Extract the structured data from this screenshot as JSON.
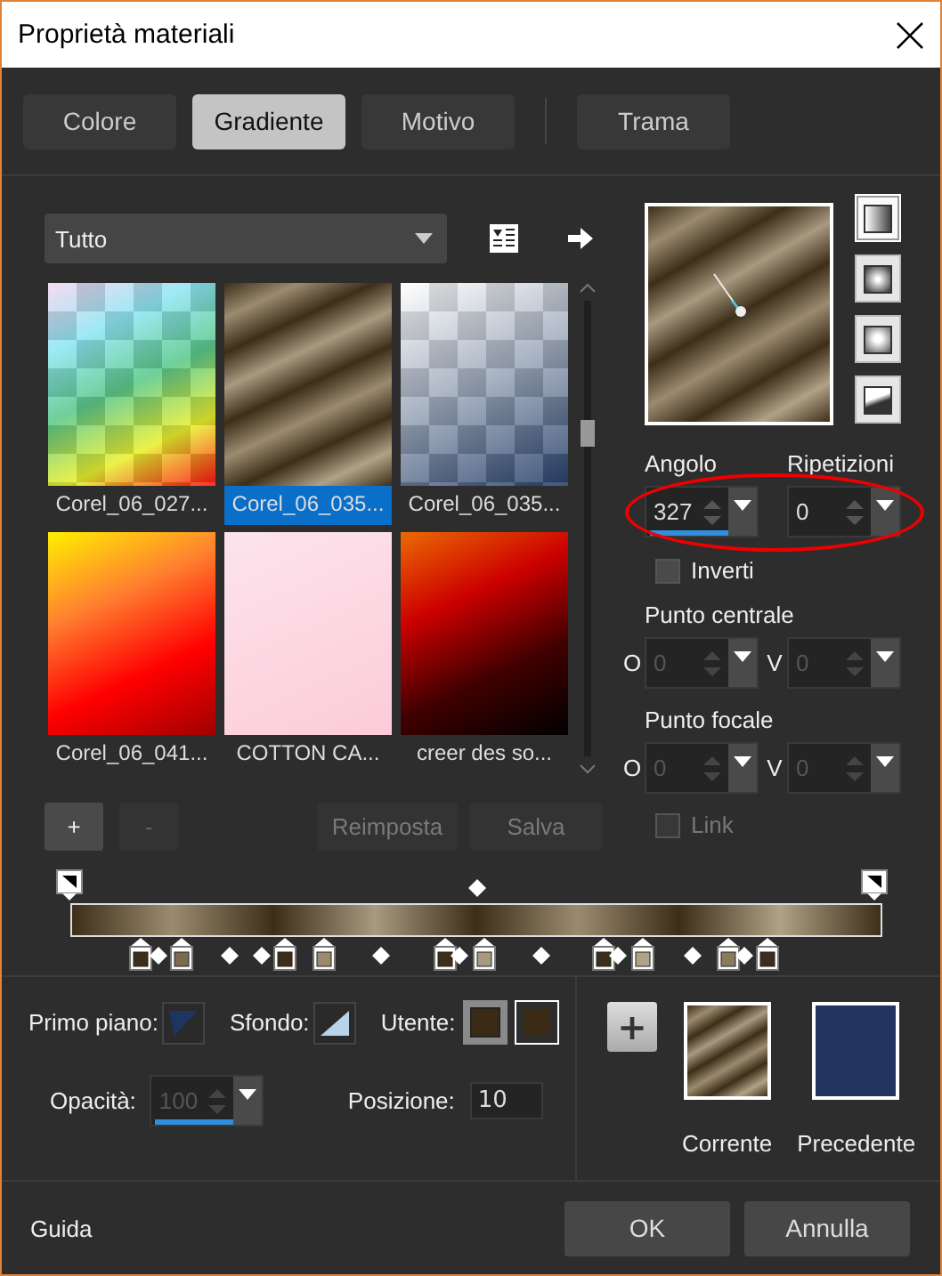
{
  "window": {
    "title": "Proprietà materiali"
  },
  "tab_groups": [
    [
      {
        "label": "Colore",
        "selected": false
      },
      {
        "label": "Gradiente",
        "selected": true
      },
      {
        "label": "Motivo",
        "selected": false
      }
    ],
    [
      {
        "label": "Trama",
        "selected": false
      }
    ]
  ],
  "library": {
    "dropdown": "Tutto",
    "items": [
      {
        "label": "Corel_06_027...",
        "selected": false
      },
      {
        "label": "Corel_06_035...",
        "selected": true
      },
      {
        "label": "Corel_06_035...",
        "selected": false
      },
      {
        "label": "Corel_06_041...",
        "selected": false
      },
      {
        "label": "COTTON CA...",
        "selected": false
      },
      {
        "label": "creer des so...",
        "selected": false
      }
    ],
    "small_buttons": [
      {
        "label": "+",
        "disabled": false
      },
      {
        "label": "-",
        "disabled": true
      }
    ],
    "buttons": [
      {
        "label": "Reimposta",
        "disabled": true
      },
      {
        "label": "Salva",
        "disabled": true
      }
    ]
  },
  "gradient_types": [
    {
      "kind": "linear",
      "selected": true
    },
    {
      "kind": "rectangular",
      "selected": false
    },
    {
      "kind": "sunburst",
      "selected": false
    },
    {
      "kind": "radial",
      "selected": false
    }
  ],
  "angle": {
    "label": "Angolo",
    "value": "327",
    "focused": true
  },
  "repeats": {
    "label": "Ripetizioni",
    "value": "0",
    "focused": false
  },
  "annotation": {
    "kind": "ellipse"
  },
  "invert": {
    "label": "Inverti",
    "checked": false,
    "disabled": false
  },
  "center_point": {
    "label": "Punto centrale",
    "disabled": true,
    "fields": [
      {
        "axis": "O",
        "value": "0"
      },
      {
        "axis": "V",
        "value": "0"
      }
    ]
  },
  "focal_point": {
    "label": "Punto focale",
    "disabled": true,
    "fields": [
      {
        "axis": "O",
        "value": "0"
      },
      {
        "axis": "V",
        "value": "0"
      }
    ]
  },
  "link": {
    "label": "Link",
    "checked": false,
    "disabled": true
  },
  "foreground": {
    "label": "Primo piano:",
    "color": "#1e3461"
  },
  "background": {
    "label": "Sfondo:",
    "color": "#b8d4ea"
  },
  "user": {
    "label": "Utente:",
    "swatches": [
      {
        "color": "#3a2b16",
        "selected": true
      },
      {
        "color": "#3a2b16",
        "selected": false
      }
    ]
  },
  "opacity": {
    "label": "Opacità:",
    "value": "100",
    "disabled": true,
    "focused": true
  },
  "position": {
    "label": "Posizione:",
    "value": "10"
  },
  "add_swatch": {
    "label": "+"
  },
  "current": {
    "label": "Corrente"
  },
  "previous": {
    "label": "Precedente",
    "color": "#22355f"
  },
  "footer": {
    "help": "Guida",
    "buttons": [
      {
        "label": "OK"
      },
      {
        "label": "Annulla"
      }
    ]
  }
}
